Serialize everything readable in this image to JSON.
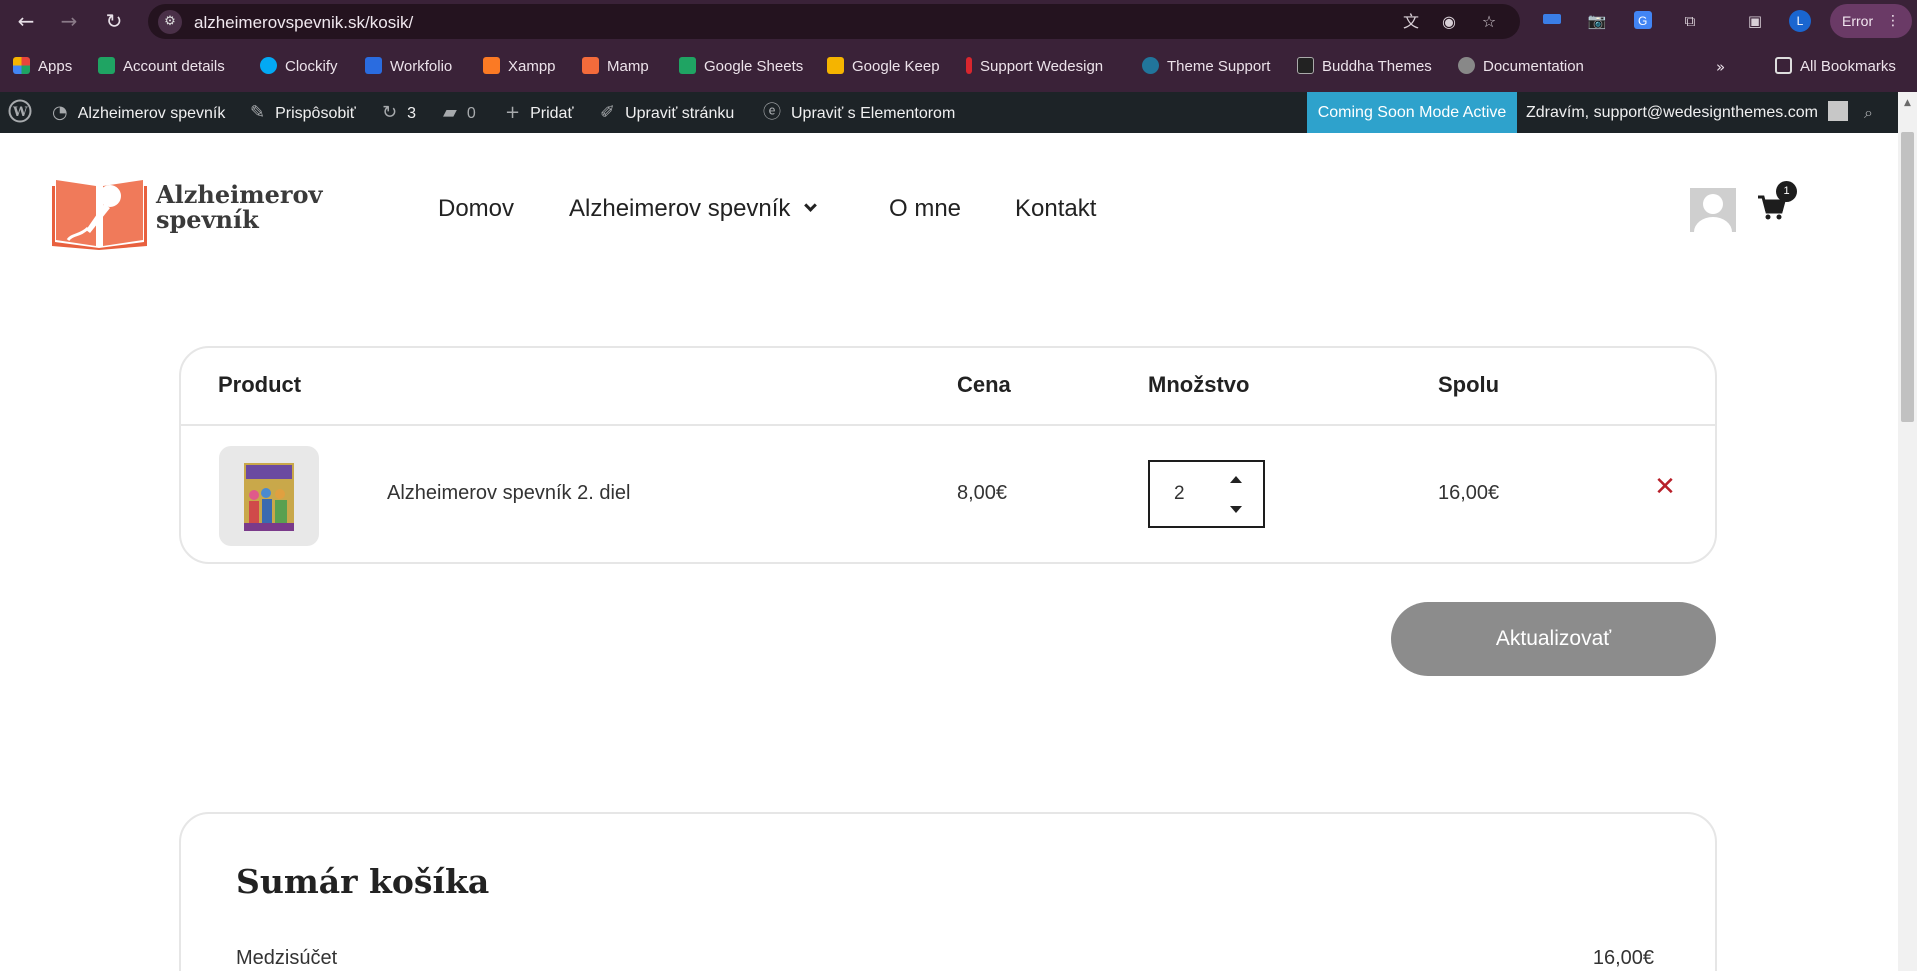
{
  "browser": {
    "url": "alzheimerovspevnik.sk/kosik/",
    "profile_initial": "L",
    "error_label": "Error",
    "bookmarks": [
      {
        "label": "Apps",
        "color": "#e8453c"
      },
      {
        "label": "Account details",
        "color": "#1fa463"
      },
      {
        "label": "Clockify",
        "color": "#03a9f4"
      },
      {
        "label": "Workfolio",
        "color": "#2a6ce0"
      },
      {
        "label": "Xampp",
        "color": "#fb7a24"
      },
      {
        "label": "Mamp",
        "color": "#f36b3b"
      },
      {
        "label": "Google Sheets",
        "color": "#1fa463"
      },
      {
        "label": "Google Keep",
        "color": "#f5b400"
      },
      {
        "label": "Support Wedesign",
        "color": "#d9262e"
      },
      {
        "label": "Theme Support",
        "color": "#21759b"
      },
      {
        "label": "Buddha Themes",
        "color": "#222222"
      },
      {
        "label": "Documentation",
        "color": "#888888"
      }
    ],
    "all_bookmarks_label": "All Bookmarks"
  },
  "adminbar": {
    "site_name": "Alzheimerov spevník",
    "customize": "Prispôsobiť",
    "updates_count": "3",
    "comments_count": "0",
    "add_new": "Pridať",
    "edit_page": "Upraviť stránku",
    "edit_elementor": "Upraviť s Elementorom",
    "coming_soon": "Coming Soon Mode Active",
    "greeting": "Zdravím, support@wedesignthemes.com"
  },
  "site": {
    "logo_line1": "Alzheimerov",
    "logo_line2": "spevník",
    "nav": [
      "Domov",
      "Alzheimerov spevník",
      "O mne",
      "Kontakt"
    ],
    "cart_count": "1",
    "accent": "#f07a5a"
  },
  "cart": {
    "headers": {
      "product": "Product",
      "price": "Cena",
      "quantity": "Množstvo",
      "total": "Spolu"
    },
    "items": [
      {
        "name": "Alzheimerov spevník 2. diel",
        "price": "8,00€",
        "quantity": "2",
        "total": "16,00€"
      }
    ],
    "update_label": "Aktualizovať"
  },
  "totals": {
    "title": "Sumár košíka",
    "subtotal_label": "Medzisúčet",
    "subtotal_value": "16,00€"
  }
}
